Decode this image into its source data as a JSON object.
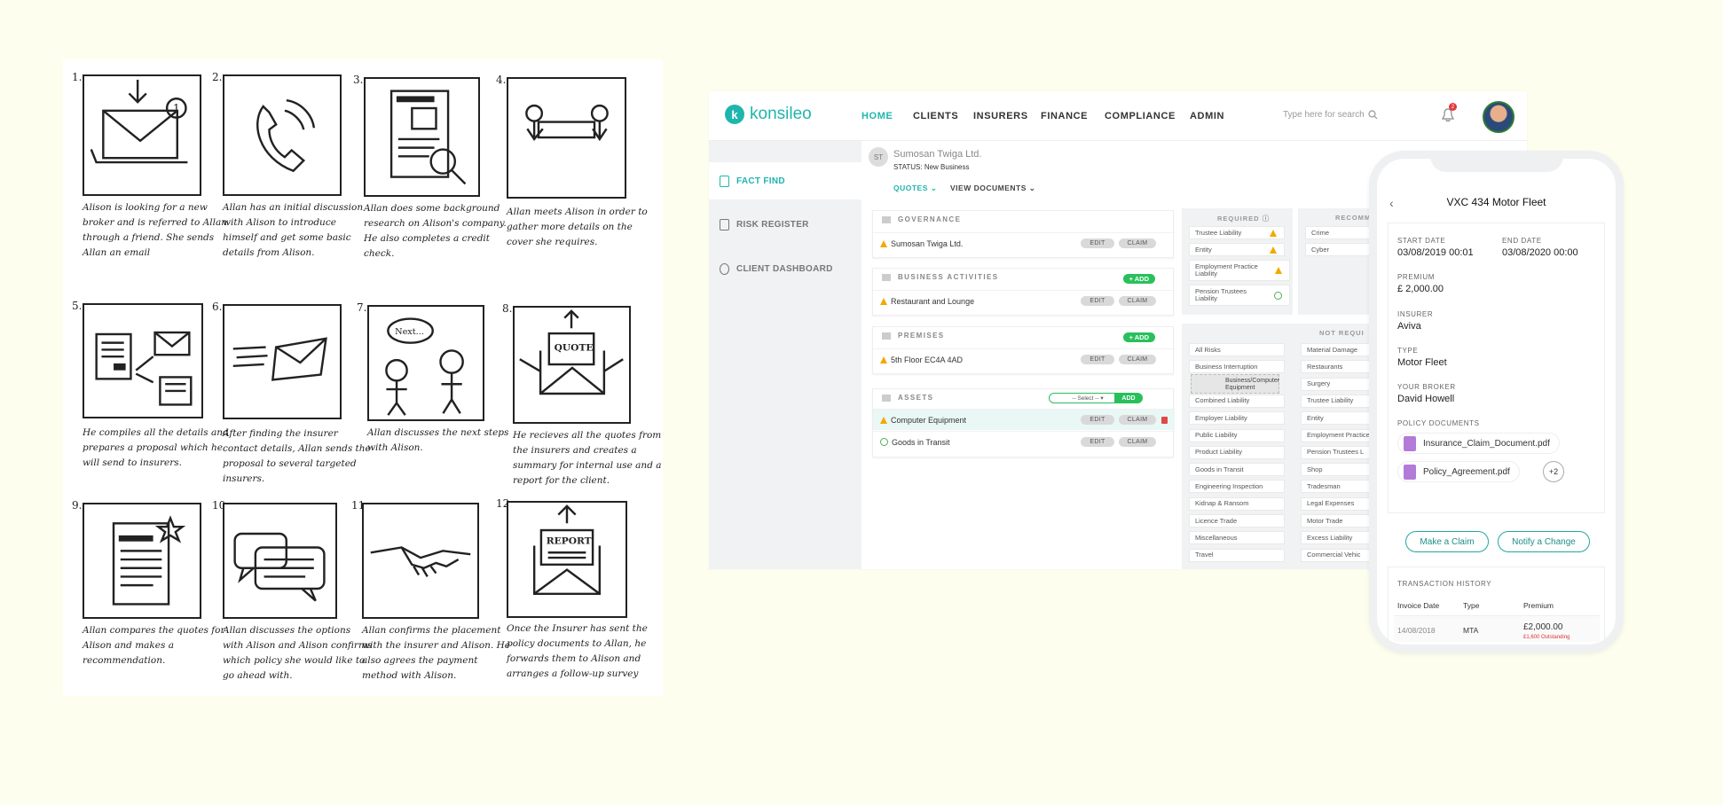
{
  "storyboard": {
    "panels": [
      {
        "num": "1.",
        "caption": "Alison is looking for a new broker and is referred to Allan through a friend. She sends Allan an email",
        "icon": "email-icon"
      },
      {
        "num": "2.",
        "caption": "Allan has an initial discussion with Alison to introduce himself and get some basic details from Alison.",
        "icon": "phone-icon"
      },
      {
        "num": "3.",
        "caption": "Allan does some background research on Alison's company. He also completes a credit check.",
        "icon": "document-search-icon"
      },
      {
        "num": "4.",
        "caption": "Allan meets Alison in order to gather more details on the cover she requires.",
        "icon": "meeting-icon"
      },
      {
        "num": "5.",
        "caption": "He compiles all the details and prepares a proposal which he will send to insurers.",
        "icon": "proposal-icon"
      },
      {
        "num": "6.",
        "caption": "After finding the insurer contact details, Allan sends the proposal to several targeted insurers.",
        "icon": "send-email-icon"
      },
      {
        "num": "7.",
        "caption": "Allan discusses the next steps with Alison.",
        "icon": "conversation-icon",
        "bubble": "Next..."
      },
      {
        "num": "8.",
        "caption": "He recieves all the quotes from the insurers and creates a summary for internal use and a report for the client.",
        "icon": "quote-icon",
        "stamp": "QUOTE"
      },
      {
        "num": "9.",
        "caption": "Allan compares the quotes for Alison and makes a recommendation.",
        "icon": "recommendation-icon"
      },
      {
        "num": "10.",
        "caption": "Allan discusses the options with Alison and Alison confirms which policy she would like to go ahead with.",
        "icon": "chat-icon"
      },
      {
        "num": "11.",
        "caption": "Allan confirms the placement with the insurer and Alison. He also agrees the payment method with Alison.",
        "icon": "handshake-icon"
      },
      {
        "num": "12.",
        "caption": "Once the Insurer has sent the policy documents to Allan, he forwards them to Alison and arranges a follow-up survey",
        "icon": "report-icon",
        "stamp": "REPORT"
      }
    ]
  },
  "app": {
    "logo": "konsileo",
    "nav": [
      "HOME",
      "CLIENTS",
      "INSURERS",
      "FINANCE",
      "COMPLIANCE",
      "ADMIN"
    ],
    "search_placeholder": "Type here for search",
    "notification_count": "2",
    "sidebar": [
      "FACT FIND",
      "RISK REGISTER",
      "CLIENT DASHBOARD"
    ],
    "client": {
      "initials": "ST",
      "name": "Sumosan Twiga Ltd.",
      "status": "STATUS: New Business"
    },
    "subtabs": [
      "QUOTES",
      "VIEW DOCUMENTS"
    ],
    "sections": {
      "governance": {
        "title": "GOVERNANCE",
        "rows": [
          "Sumosan Twiga Ltd."
        ]
      },
      "business": {
        "title": "BUSINESS ACTIVITIES",
        "rows": [
          "Restaurant and Lounge"
        ],
        "add": "+ ADD"
      },
      "premises": {
        "title": "PREMISES",
        "rows": [
          "5th Floor EC4A 4AD"
        ],
        "add": "+ ADD"
      },
      "assets": {
        "title": "ASSETS",
        "rows": [
          "Computer Equipment",
          "Goods in Transit"
        ],
        "select": "-- Select --",
        "add": "ADD"
      }
    },
    "edit_label": "EDIT",
    "claim_label": "CLAIM",
    "required": {
      "title": "REQUIRED",
      "items": [
        "Trustee Liability",
        "Entity",
        "Employment Practice Liability",
        "Pension Trustees Liability"
      ]
    },
    "recommended": {
      "title": "RECOMMEN",
      "items": [
        "Crime",
        "Cyber"
      ]
    },
    "not_required": {
      "title": "NOT REQUI",
      "left": [
        "All Risks",
        "Business Interruption",
        "",
        "Combined Liability",
        "Employer Liability",
        "Public Liability",
        "Product Liability",
        "Goods in Transit",
        "Engineering Inspection",
        "Kidnap & Ransom",
        "Licence Trade",
        "Miscellaneous",
        "Travel"
      ],
      "right": [
        "Material Damage",
        "Restaurants",
        "Surgery",
        "Trustee Liability",
        "Entity",
        "Employment Practice Liability",
        "Pension Trustees L",
        "Shop",
        "Tradesman",
        "Legal Expenses",
        "Motor Trade",
        "Excess Liability",
        "Commercial Vehic"
      ],
      "dragging": "Business/Computer Equipment"
    }
  },
  "phone": {
    "title": "VXC 434 Motor Fleet",
    "start_label": "START DATE",
    "start_value": "03/08/2019 00:01",
    "end_label": "END DATE",
    "end_value": "03/08/2020 00:00",
    "premium_label": "PREMIUM",
    "premium_value": "£ 2,000.00",
    "insurer_label": "INSURER",
    "insurer_value": "Aviva",
    "type_label": "TYPE",
    "type_value": "Motor Fleet",
    "broker_label": "YOUR BROKER",
    "broker_value": "David Howell",
    "docs_label": "POLICY DOCUMENTS",
    "docs": [
      "Insurance_Claim_Document.pdf",
      "Policy_Agreement.pdf"
    ],
    "more_docs": "+2",
    "claim_button": "Make a Claim",
    "change_button": "Notify a Change",
    "history_label": "TRANSACTION HISTORY",
    "history_headers": [
      "Invoice Date",
      "Type",
      "Premium"
    ],
    "history_rows": [
      {
        "date": "14/08/2018",
        "type": "MTA",
        "premium": "£2,000.00",
        "outstanding": "£1,600 Outstanding"
      }
    ]
  },
  "colors": {
    "brand": "#1fb5ad",
    "add": "#29c05c",
    "warning": "#f2a900",
    "background": "#fdfeee"
  }
}
